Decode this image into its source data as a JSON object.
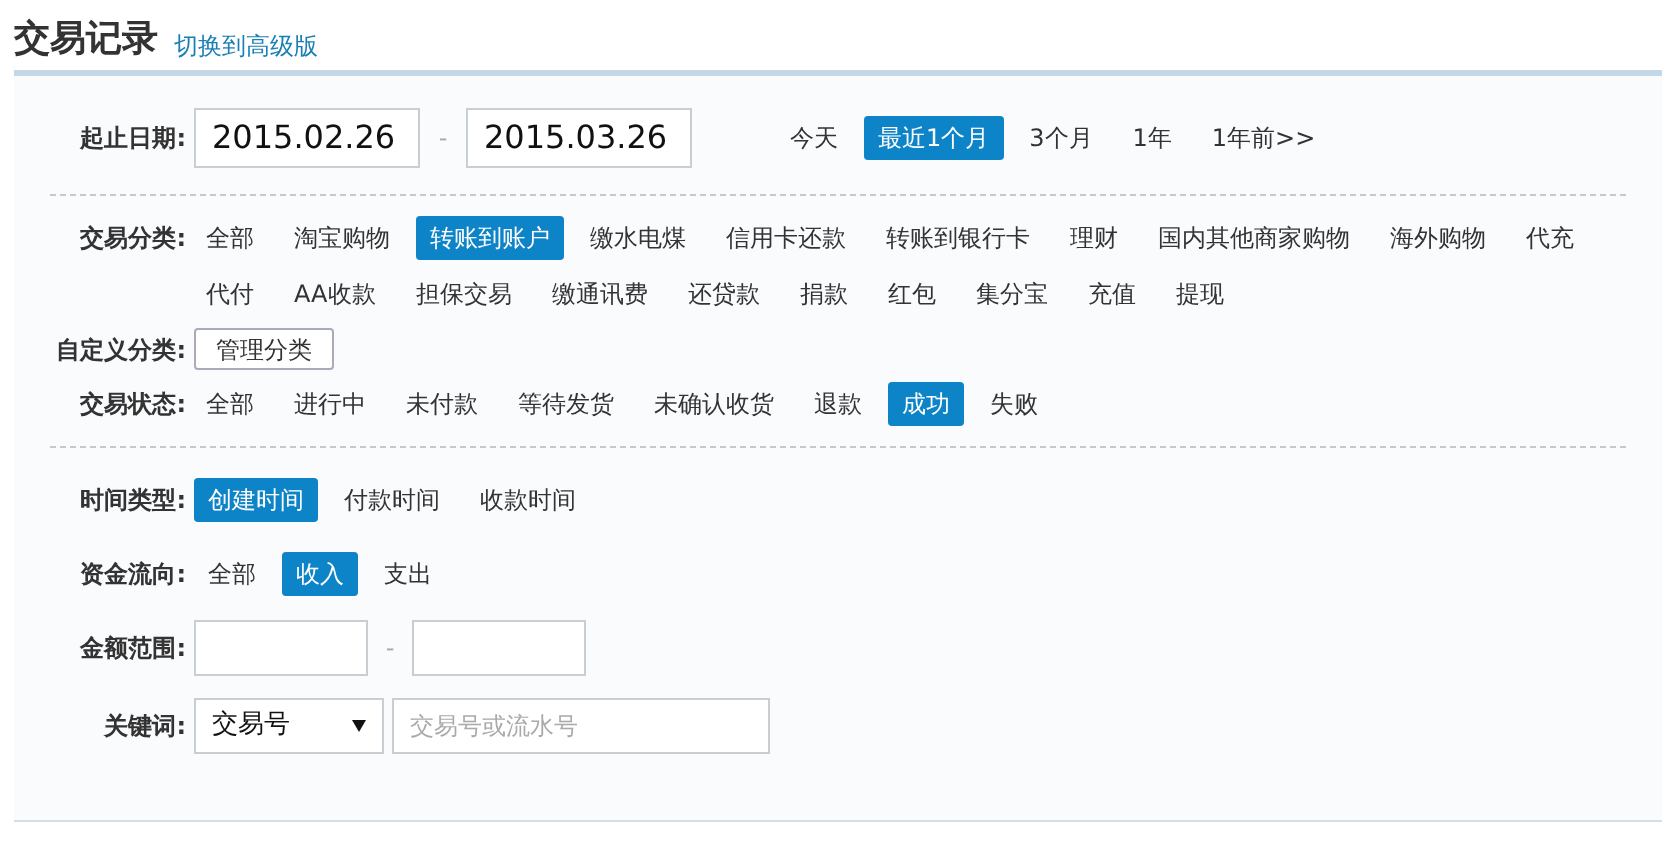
{
  "title": "交易记录",
  "mode_link": "切换到高级版",
  "date_range": {
    "label": "起止日期:",
    "start": "2015.02.26",
    "separator": "-",
    "end": "2015.03.26",
    "presets": [
      {
        "label": "今天",
        "selected": false
      },
      {
        "label": "最近1个月",
        "selected": true
      },
      {
        "label": "3个月",
        "selected": false
      },
      {
        "label": "1年",
        "selected": false
      },
      {
        "label": "1年前>>",
        "selected": false
      }
    ]
  },
  "categories": {
    "label": "交易分类:",
    "options": [
      {
        "label": "全部",
        "selected": false
      },
      {
        "label": "淘宝购物",
        "selected": false
      },
      {
        "label": "转账到账户",
        "selected": true
      },
      {
        "label": "缴水电煤",
        "selected": false
      },
      {
        "label": "信用卡还款",
        "selected": false
      },
      {
        "label": "转账到银行卡",
        "selected": false
      },
      {
        "label": "理财",
        "selected": false
      },
      {
        "label": "国内其他商家购物",
        "selected": false
      },
      {
        "label": "海外购物",
        "selected": false
      },
      {
        "label": "代充",
        "selected": false
      },
      {
        "label": "代付",
        "selected": false
      },
      {
        "label": "AA收款",
        "selected": false
      },
      {
        "label": "担保交易",
        "selected": false
      },
      {
        "label": "缴通讯费",
        "selected": false
      },
      {
        "label": "还贷款",
        "selected": false
      },
      {
        "label": "捐款",
        "selected": false
      },
      {
        "label": "红包",
        "selected": false
      },
      {
        "label": "集分宝",
        "selected": false
      },
      {
        "label": "充值",
        "selected": false
      },
      {
        "label": "提现",
        "selected": false
      }
    ]
  },
  "custom_category": {
    "label": "自定义分类:",
    "button": "管理分类"
  },
  "status": {
    "label": "交易状态:",
    "options": [
      {
        "label": "全部",
        "selected": false
      },
      {
        "label": "进行中",
        "selected": false
      },
      {
        "label": "未付款",
        "selected": false
      },
      {
        "label": "等待发货",
        "selected": false
      },
      {
        "label": "未确认收货",
        "selected": false
      },
      {
        "label": "退款",
        "selected": false
      },
      {
        "label": "成功",
        "selected": true
      },
      {
        "label": "失败",
        "selected": false
      }
    ]
  },
  "time_type": {
    "label": "时间类型:",
    "options": [
      {
        "label": "创建时间",
        "selected": true
      },
      {
        "label": "付款时间",
        "selected": false
      },
      {
        "label": "收款时间",
        "selected": false
      }
    ]
  },
  "flow": {
    "label": "资金流向:",
    "options": [
      {
        "label": "全部",
        "selected": false
      },
      {
        "label": "收入",
        "selected": true
      },
      {
        "label": "支出",
        "selected": false
      }
    ]
  },
  "amount": {
    "label": "金额范围:",
    "separator": "-"
  },
  "keyword": {
    "label": "关键词:",
    "select": {
      "value": "交易号"
    },
    "input": {
      "placeholder": "交易号或流水号"
    }
  }
}
